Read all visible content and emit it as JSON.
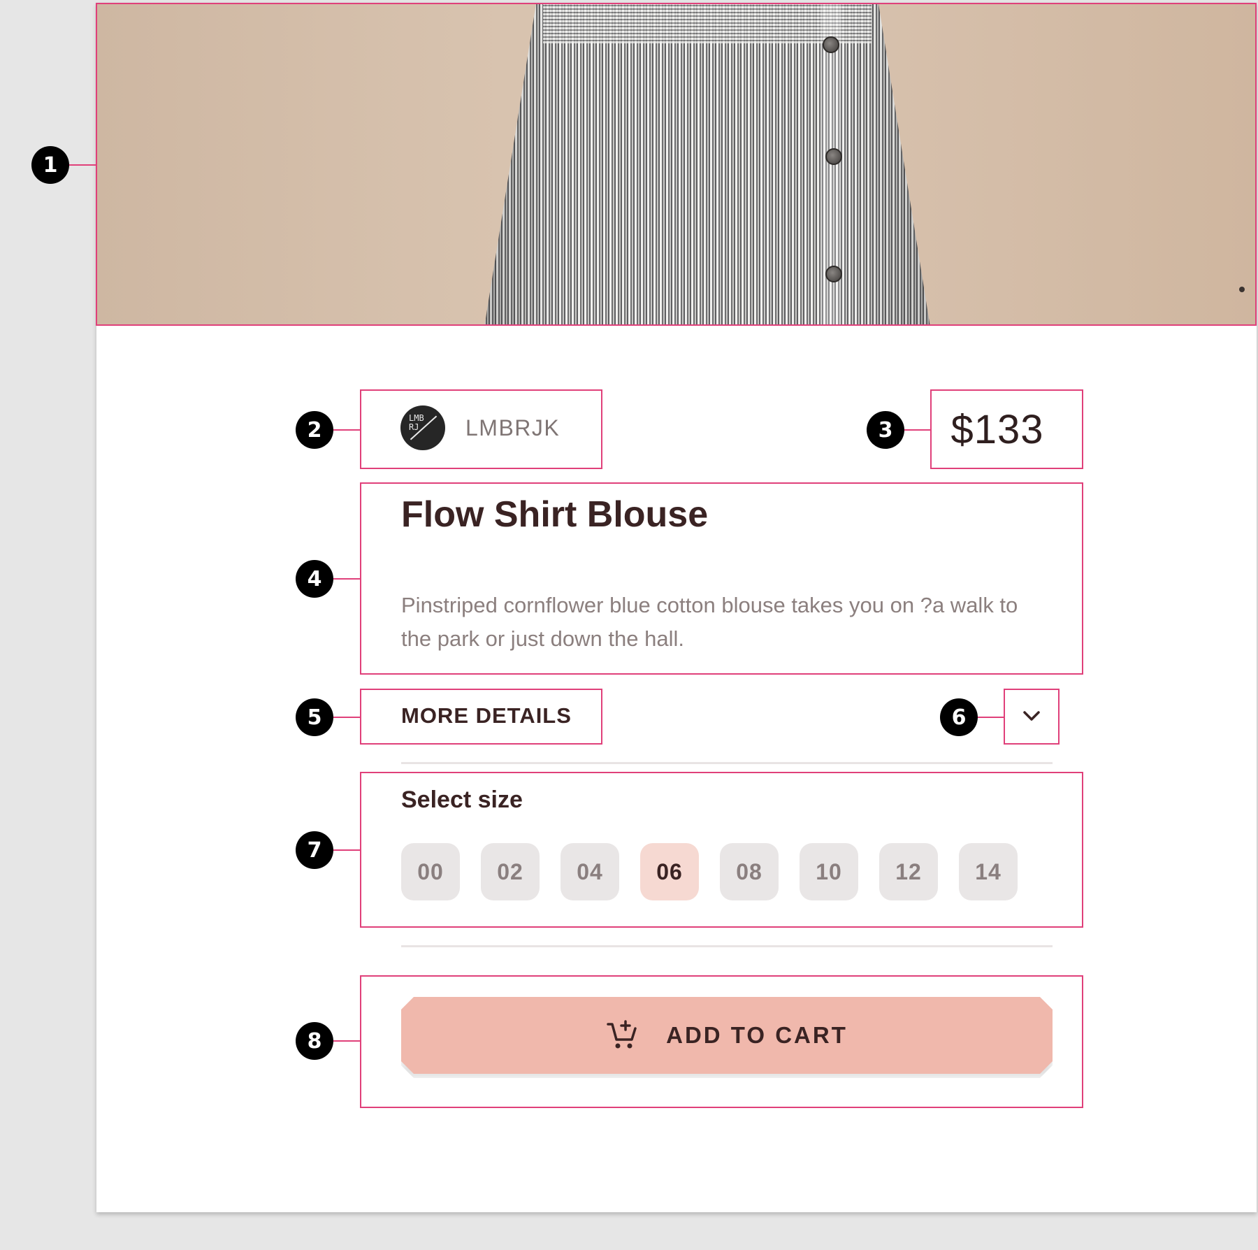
{
  "product": {
    "brand": {
      "name": "LMBRJK",
      "logo_text": "LMB RJ"
    },
    "price": "$133",
    "title": "Flow Shirt Blouse",
    "description": "Pinstriped cornflower blue cotton blouse takes you on ?a walk to the park or just down the hall."
  },
  "details": {
    "label": "MORE DETAILS",
    "expand_icon": "chevron-down-icon"
  },
  "size": {
    "label": "Select size",
    "options": [
      "00",
      "02",
      "04",
      "06",
      "08",
      "10",
      "12",
      "14"
    ],
    "selected": "06"
  },
  "cart": {
    "label": "ADD TO CART",
    "icon": "add-to-cart-icon"
  },
  "annotations": [
    "1",
    "2",
    "3",
    "4",
    "5",
    "6",
    "7",
    "8"
  ],
  "colors": {
    "accent": "#f0b8ac",
    "selected_chip": "#f6d9d2",
    "annotation_outline": "#e0407a",
    "text_primary": "#3a2323"
  }
}
